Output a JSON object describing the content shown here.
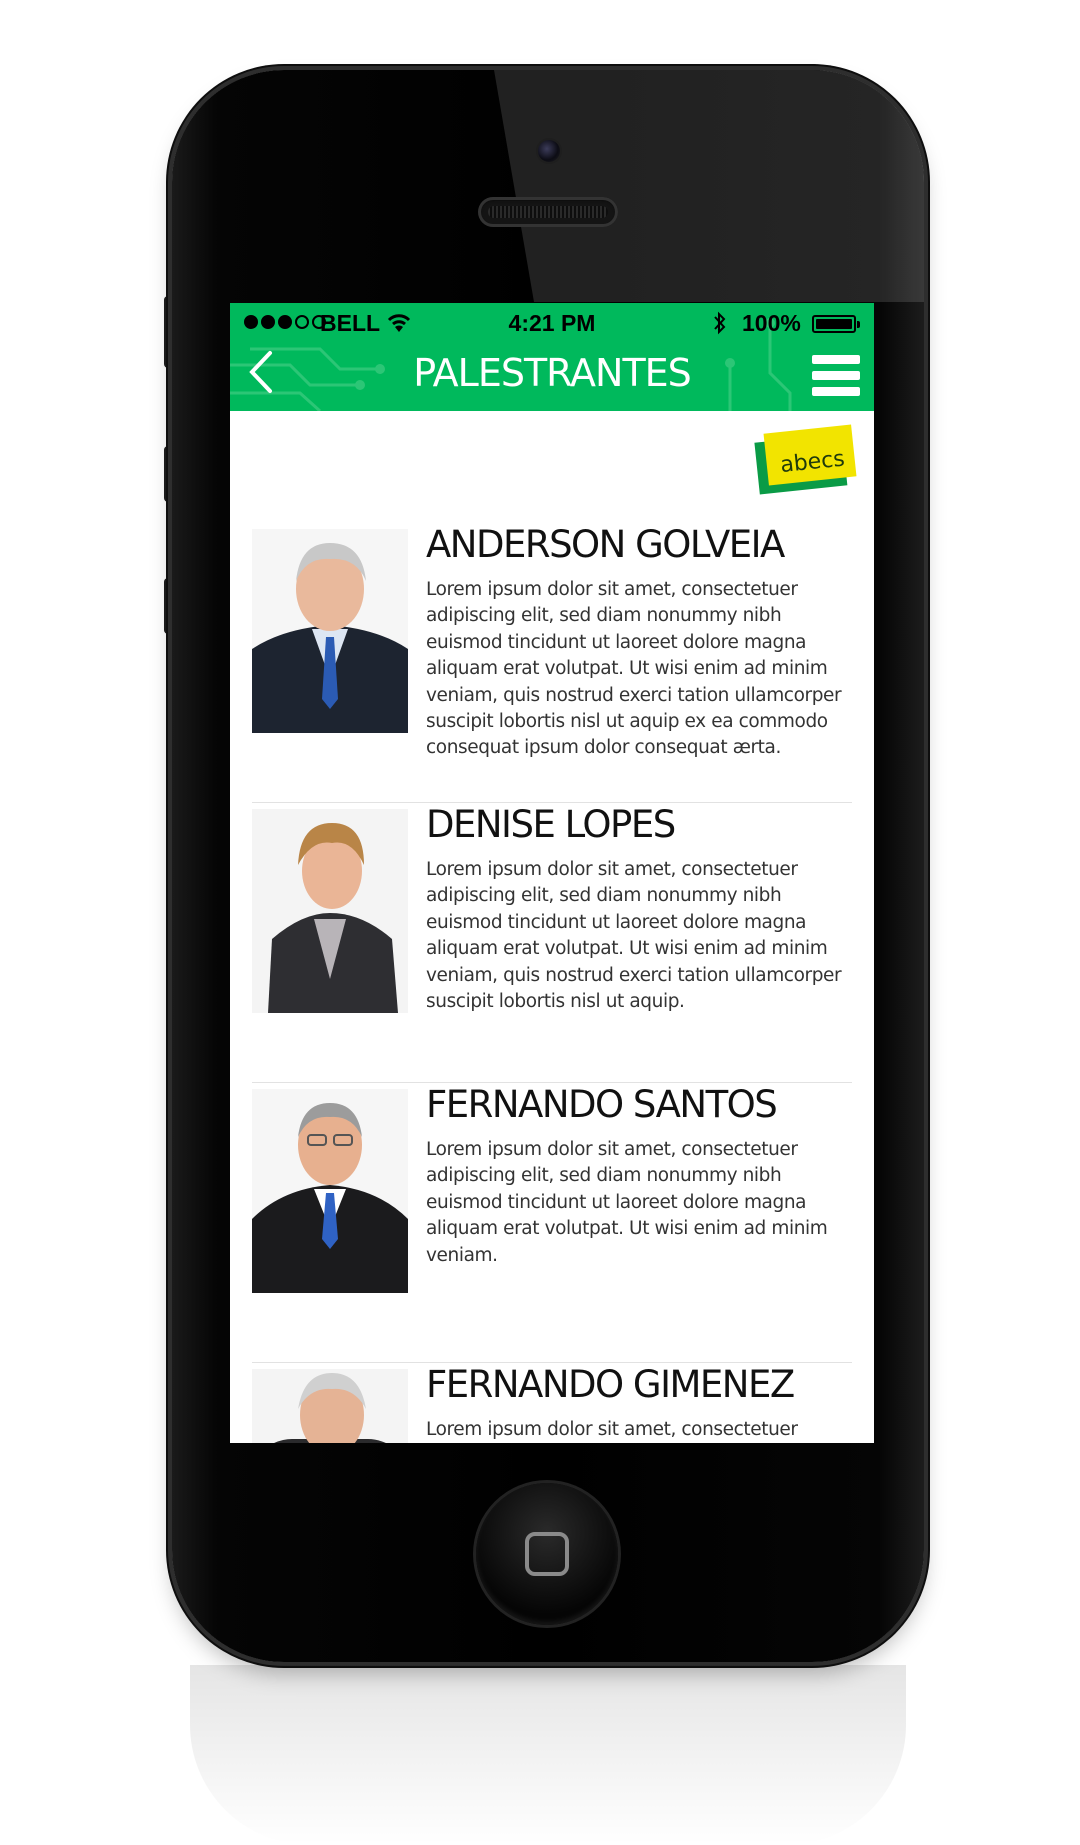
{
  "status_bar": {
    "carrier": "BELL",
    "time": "4:21 PM",
    "battery": "100%"
  },
  "header": {
    "title": "PALESTRANTES"
  },
  "logo": {
    "text": "abecs"
  },
  "speakers": [
    {
      "name": "ANDERSON GOLVEIA",
      "bio": "Lorem ipsum dolor sit amet, consectetuer adipiscing elit, sed diam nonummy nibh euismod tincidunt ut laoreet dolore magna aliquam erat volutpat. Ut wisi enim ad minim veniam, quis nostrud exerci tation ullamcorper suscipit lobortis nisl ut aquip ex ea commodo consequat ipsum dolor consequat ærta."
    },
    {
      "name": "DENISE LOPES",
      "bio": "Lorem ipsum dolor sit amet, consectetuer adipiscing elit, sed diam nonummy nibh euismod tincidunt ut laoreet dolore magna aliquam erat volutpat. Ut wisi enim ad minim veniam, quis nostrud exerci tation ullamcorper suscipit lobortis nisl ut aquip."
    },
    {
      "name": "FERNANDO SANTOS",
      "bio": "Lorem ipsum dolor sit amet, consectetuer adipiscing elit, sed diam nonummy nibh euismod tincidunt ut laoreet dolore magna aliquam erat volutpat. Ut wisi enim ad minim veniam."
    },
    {
      "name": "FERNANDO GIMENEZ",
      "bio": "Lorem ipsum dolor sit amet, consectetuer adipiscing"
    }
  ]
}
